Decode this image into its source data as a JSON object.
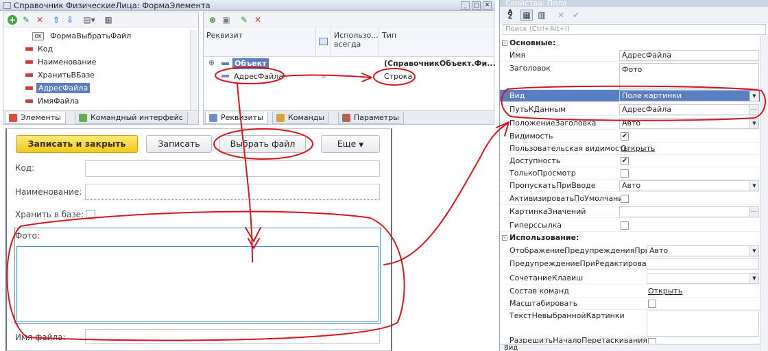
{
  "window": {
    "title": "Справочник ФизическиеЛица: ФормаЭлемента"
  },
  "elements_tree": {
    "items": [
      {
        "label": "ФормаВыбратьФайл",
        "kind": "ok"
      },
      {
        "label": "Код",
        "kind": "field"
      },
      {
        "label": "Наименование",
        "kind": "field"
      },
      {
        "label": "ХранитьВБазе",
        "kind": "field"
      },
      {
        "label": "АдресФайла",
        "kind": "field",
        "selected": true
      },
      {
        "label": "ИмяФайла",
        "kind": "field"
      }
    ],
    "tabs": [
      "Элементы",
      "Командный интерфейс"
    ]
  },
  "attributes": {
    "columns": [
      "Реквизит",
      "Использо... всегда",
      "Тип"
    ],
    "rows": [
      {
        "name": "Объект",
        "type": "(СправочникОбъект.Фи..."
      },
      {
        "name": "АдресФайла",
        "type": "Строка"
      }
    ],
    "tabs": [
      "Реквизиты",
      "Команды",
      "Параметры"
    ]
  },
  "form": {
    "buttons": {
      "save_close": "Записать и закрыть",
      "save": "Записать",
      "choose_file": "Выбрать файл",
      "more": "Еще"
    },
    "fields": {
      "code": "Код:",
      "name": "Наименование:",
      "store": "Хранить в базе:",
      "photo": "Фото:",
      "filename": "Имя файла:"
    }
  },
  "properties": {
    "title": "Свойства: Поле",
    "search_placeholder": "Поиск (Ctrl+Alt+I)",
    "sections": {
      "main": "Основные:",
      "usage": "Использование:"
    },
    "rows": {
      "name": {
        "label": "Имя",
        "value": "АдресФайла"
      },
      "header": {
        "label": "Заголовок",
        "value": "Фото"
      },
      "view": {
        "label": "Вид",
        "value": "Поле картинки"
      },
      "datapath": {
        "label": "ПутьКДанным",
        "value": "АдресФайла"
      },
      "titlepos": {
        "label": "ПоложениеЗаголовка",
        "value": "Авто"
      },
      "visible": {
        "label": "Видимость",
        "checked": true
      },
      "uservis": {
        "label": "Пользовательская видимость",
        "link": "Открыть"
      },
      "enabled": {
        "label": "Доступность",
        "checked": true
      },
      "readonly": {
        "label": "ТолькоПросмотр",
        "checked": false
      },
      "skip": {
        "label": "ПропускатьПриВводе",
        "value": "Авто"
      },
      "activate": {
        "label": "АктивизироватьПоУмолчанию",
        "checked": false
      },
      "pic": {
        "label": "КартинкаЗначений",
        "value": ""
      },
      "hyper": {
        "label": "Гиперссылка",
        "checked": false
      },
      "warnshow": {
        "label": "ОтображениеПредупрежденияПриРеда",
        "value": "Авто"
      },
      "warn": {
        "label": "ПредупреждениеПриРедактировании",
        "value": ""
      },
      "keys": {
        "label": "СочетаниеКлавиш",
        "value": ""
      },
      "cmds": {
        "label": "Состав команд",
        "link": "Открыть"
      },
      "scale": {
        "label": "Масштабировать",
        "checked": false
      },
      "notext": {
        "label": "ТекстНевыбраннойКартинки",
        "value": ""
      },
      "allowdrag": {
        "label": "РазрешитьНачалоПеретаскивания",
        "checked": false
      }
    },
    "status": "Вид"
  },
  "colors": {
    "accent_selected": "#5a7fc0",
    "annotation": "#d8141b",
    "primary_button": "#f3c916"
  }
}
